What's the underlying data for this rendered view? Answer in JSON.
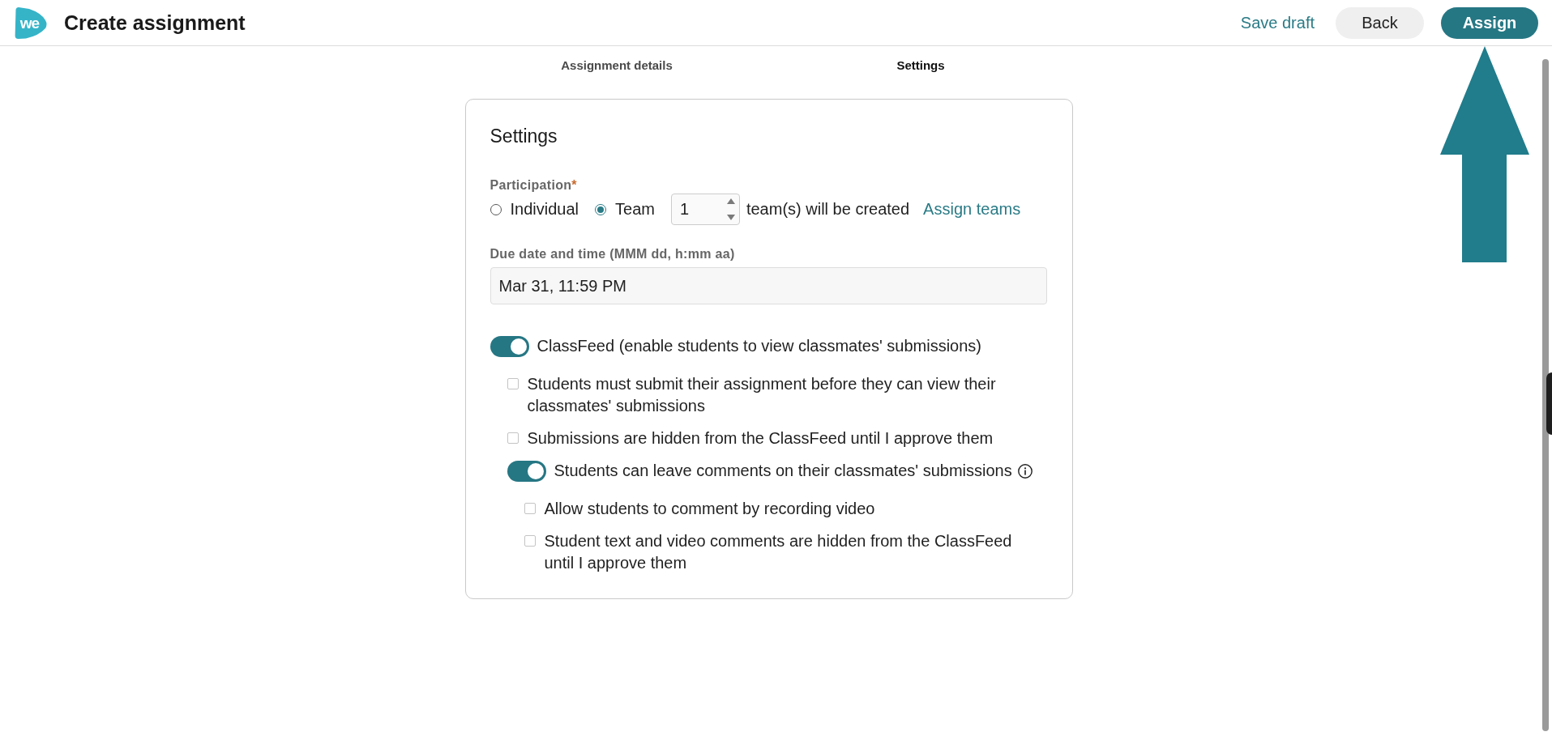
{
  "header": {
    "logo": "we",
    "title": "Create assignment",
    "save_draft": "Save draft",
    "buttons": [
      {
        "label": "Back",
        "kind": "secondary"
      },
      {
        "label": "Assign",
        "kind": "primary"
      }
    ]
  },
  "tabs": [
    {
      "label": "Assignment details",
      "selected": false
    },
    {
      "label": "Settings",
      "selected": true
    }
  ],
  "settings": {
    "title": "Settings",
    "participation": {
      "label": "Participation",
      "required_mark": "*",
      "options": [
        {
          "label": "Individual",
          "selected": false
        },
        {
          "label": "Team",
          "selected": true
        }
      ],
      "team_count": "1",
      "team_count_suffix": "team(s) will be created",
      "assign_link": "Assign teams"
    },
    "due_date": {
      "label": "Due date and time (MMM dd, h:mm aa)",
      "value": "Mar 31, 11:59 PM"
    },
    "options": [
      {
        "kind": "toggle",
        "label": "ClassFeed (enable students to view classmates' submissions)",
        "on": true,
        "children": [
          {
            "kind": "checkbox",
            "label": "Students must submit their assignment before they can view their classmates' submissions",
            "checked": false
          },
          {
            "kind": "checkbox",
            "label": "Submissions are hidden from the ClassFeed until I approve them",
            "checked": false
          },
          {
            "kind": "toggle",
            "label": "Students can leave comments on their classmates' submissions",
            "on": true,
            "info": true,
            "children": [
              {
                "kind": "checkbox",
                "label": "Allow students to comment by recording video",
                "checked": false
              },
              {
                "kind": "checkbox",
                "label": "Student text and video comments are hidden from the ClassFeed until I approve them",
                "checked": false
              }
            ]
          }
        ]
      }
    ]
  }
}
